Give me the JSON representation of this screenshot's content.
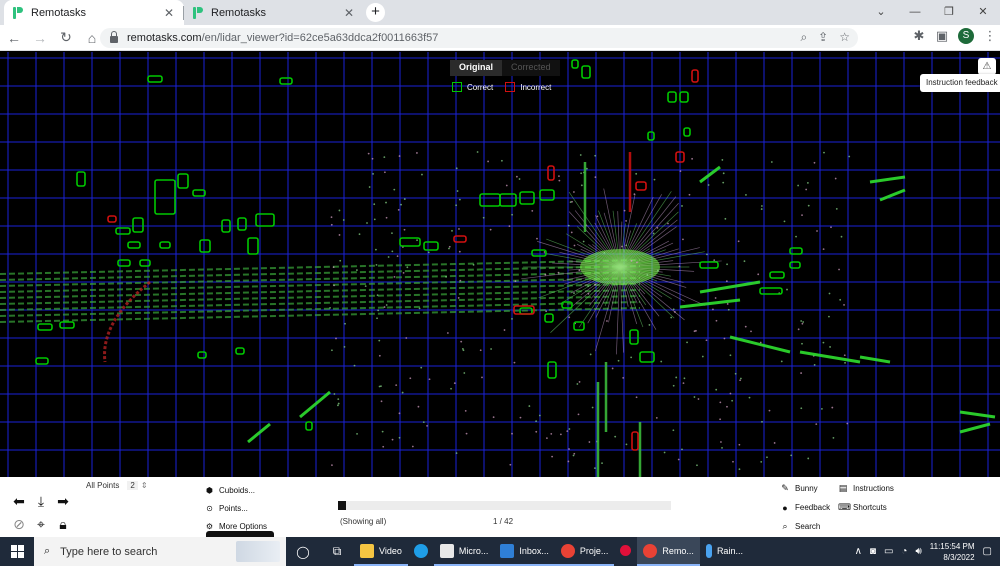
{
  "browser": {
    "tabs": [
      {
        "title": "Remotasks",
        "active": true
      },
      {
        "title": "Remotasks",
        "active": false
      }
    ],
    "url_host": "remotasks.com",
    "url_path": "/en/lidar_viewer?id=62ce5a63ddca2f0011663f57",
    "profile_initial": "S"
  },
  "viewer": {
    "toggle": {
      "original": "Original",
      "corrected": "Corrected"
    },
    "legend": {
      "correct": "Correct",
      "incorrect": "Incorrect",
      "correct_color": "#00c800",
      "incorrect_color": "#d01010"
    },
    "feedback_tooltip": "Instruction feedback",
    "grid_color": "#1a22d8"
  },
  "controls": {
    "all_points_label": "All Points",
    "all_points_count": "2",
    "menu": {
      "cuboids": "Cuboids...",
      "points": "Points...",
      "more_options": "More Options"
    },
    "progress": {
      "label": "(Showing all)",
      "count": "1 / 42",
      "fraction": 0.024
    },
    "help": {
      "bunny": "Bunny",
      "instructions": "Instructions",
      "feedback": "Feedback",
      "shortcuts": "Shortcuts",
      "search": "Search"
    }
  },
  "taskbar": {
    "search_placeholder": "Type here to search",
    "apps": [
      {
        "label": "Video",
        "color": "#f5c542"
      },
      {
        "label": "",
        "color": "#1f9ee8"
      },
      {
        "label": "Micro...",
        "color": "#e8e8e8"
      },
      {
        "label": "Inbox...",
        "color": "#2f7fd6"
      },
      {
        "label": "Proje...",
        "color": "#e94235"
      },
      {
        "label": "",
        "color": "#e0103a"
      },
      {
        "label": "Remo...",
        "color": "#e94235"
      },
      {
        "label": "Rain...",
        "color": "#4aa3f0"
      }
    ],
    "time": "11:15:54 PM",
    "date": "8/3/2022"
  }
}
